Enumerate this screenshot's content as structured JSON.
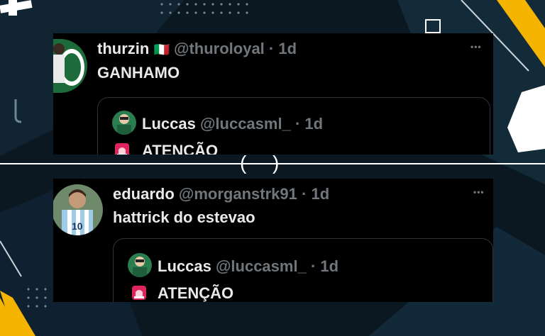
{
  "posts": [
    {
      "author": "thurzin",
      "flag": "🇮🇹",
      "handle": "@thuroloyal",
      "time": "· 1d",
      "text": "GANHAMO",
      "more": "•••",
      "quote": {
        "author": "Luccas",
        "handle": "@luccasml_",
        "time": "· 1d",
        "text": "ATENÇÃO"
      }
    },
    {
      "author": "eduardo",
      "handle": "@morganstrk91",
      "time": "· 1d",
      "text": "hattrick do estevao",
      "more": "•••",
      "quote": {
        "author": "Luccas",
        "handle": "@luccasml_",
        "time": "· 1d",
        "text": "ATENÇÃO"
      }
    }
  ],
  "divider": {
    "left": "(",
    "right": ")"
  },
  "colors": {
    "accent_yellow": "#f5b400",
    "background": "#0b1822",
    "card": "#000000",
    "muted_text": "#71767b",
    "siren_red": "#e0245e"
  }
}
